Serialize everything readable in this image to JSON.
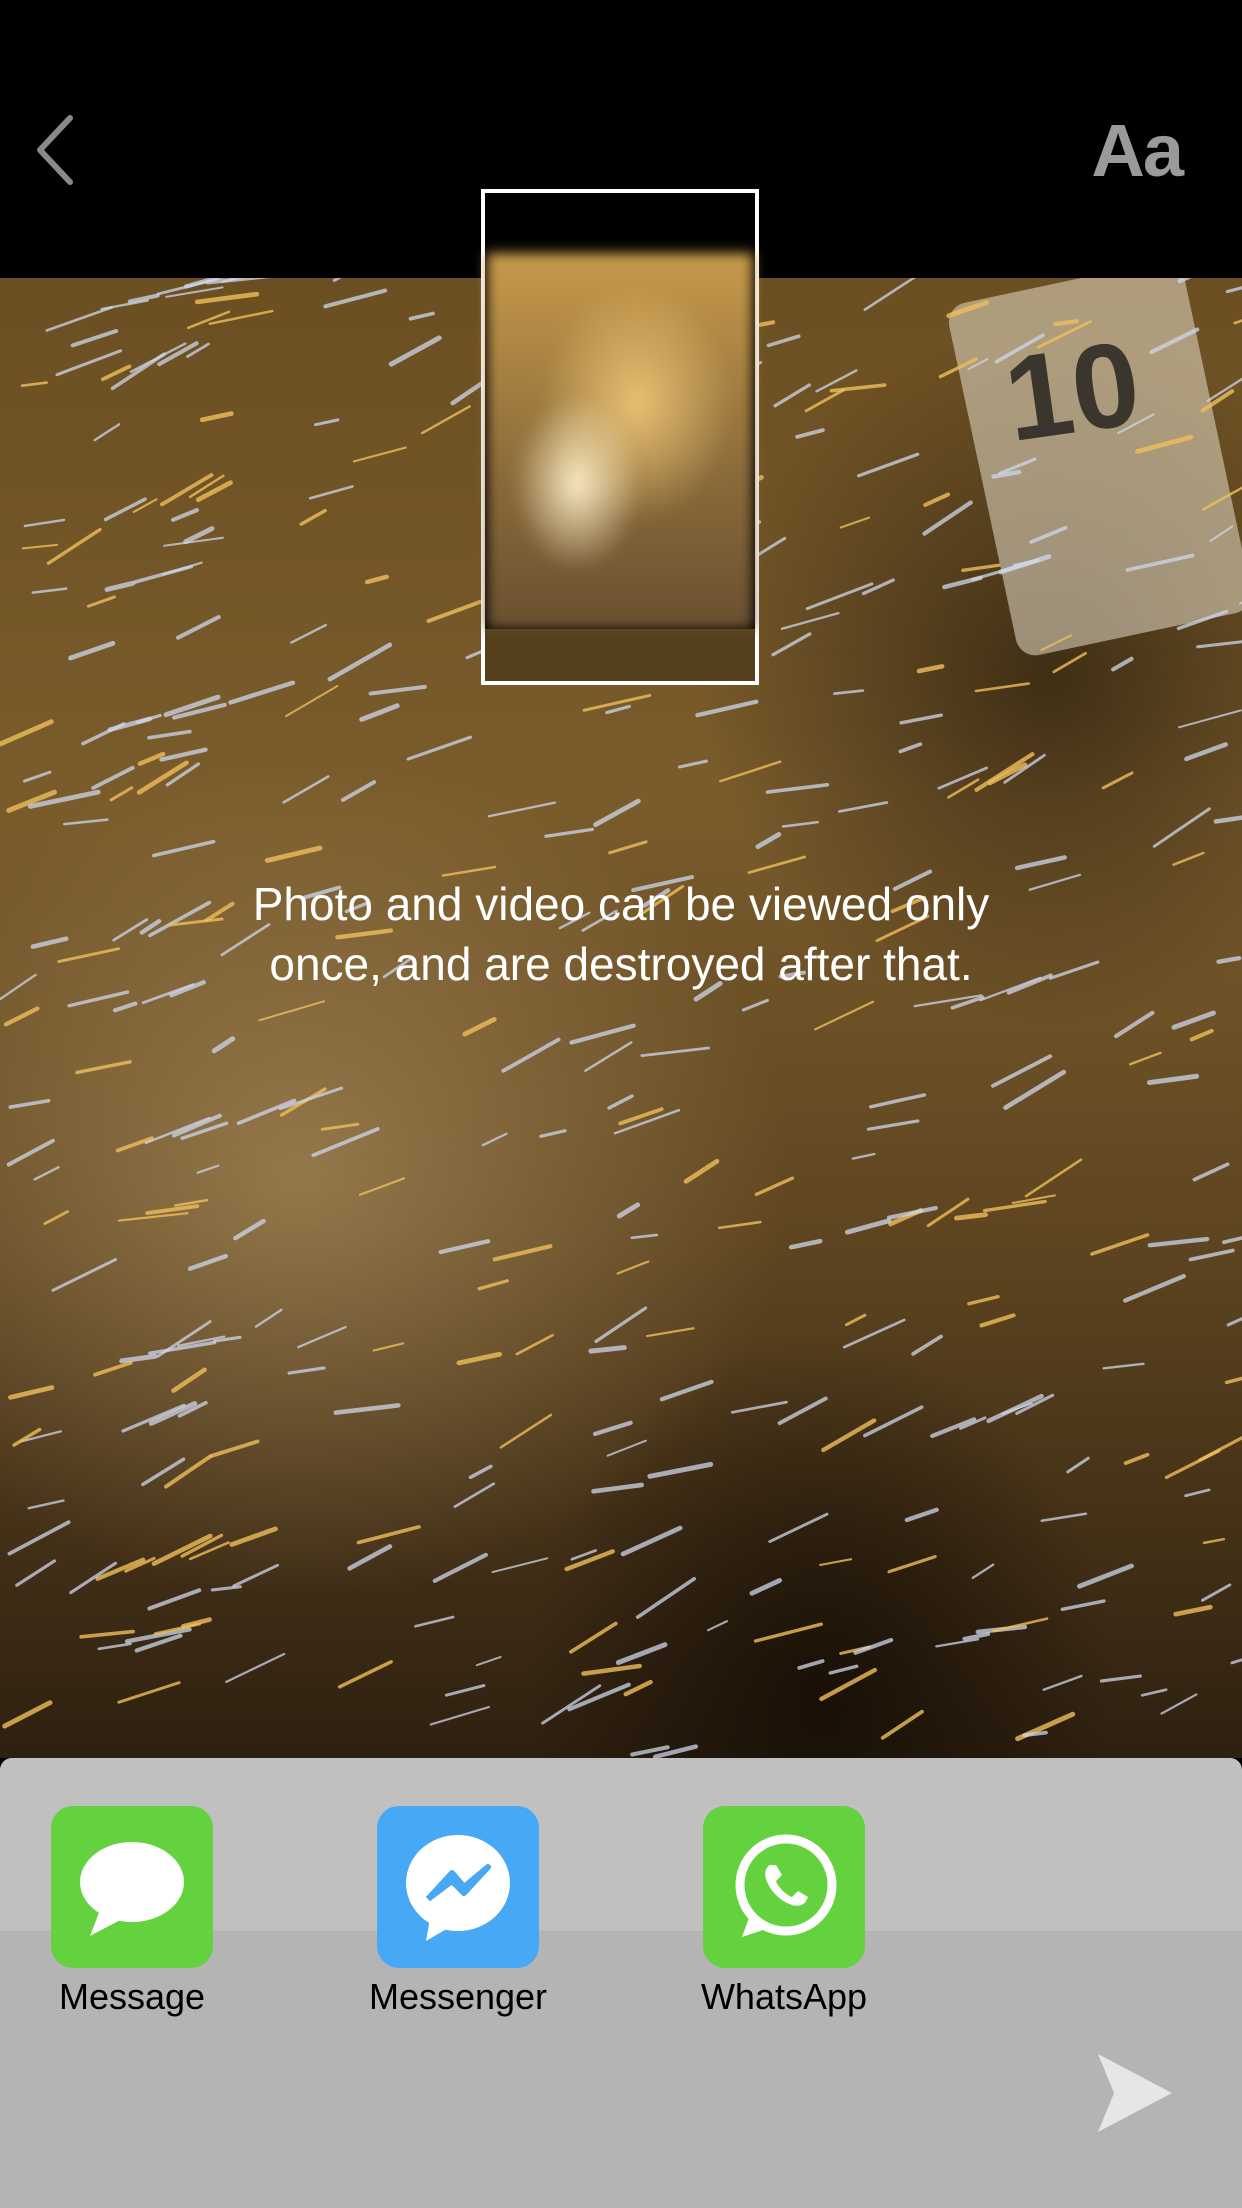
{
  "header": {
    "back_icon": "chevron-left-icon",
    "font_button_label": "Aa"
  },
  "photo": {
    "jersey_number": "10"
  },
  "notice": "Photo and video can be viewed only once, and are destroyed after that.",
  "share_apps": [
    {
      "label": "Message",
      "icon": "speech-bubble-icon",
      "color": "#63d23e"
    },
    {
      "label": "Messenger",
      "icon": "messenger-bolt-icon",
      "color": "#47a8f6"
    },
    {
      "label": "WhatsApp",
      "icon": "whatsapp-phone-icon",
      "color": "#63d23e"
    }
  ],
  "send": {
    "icon": "send-arrow-icon"
  }
}
